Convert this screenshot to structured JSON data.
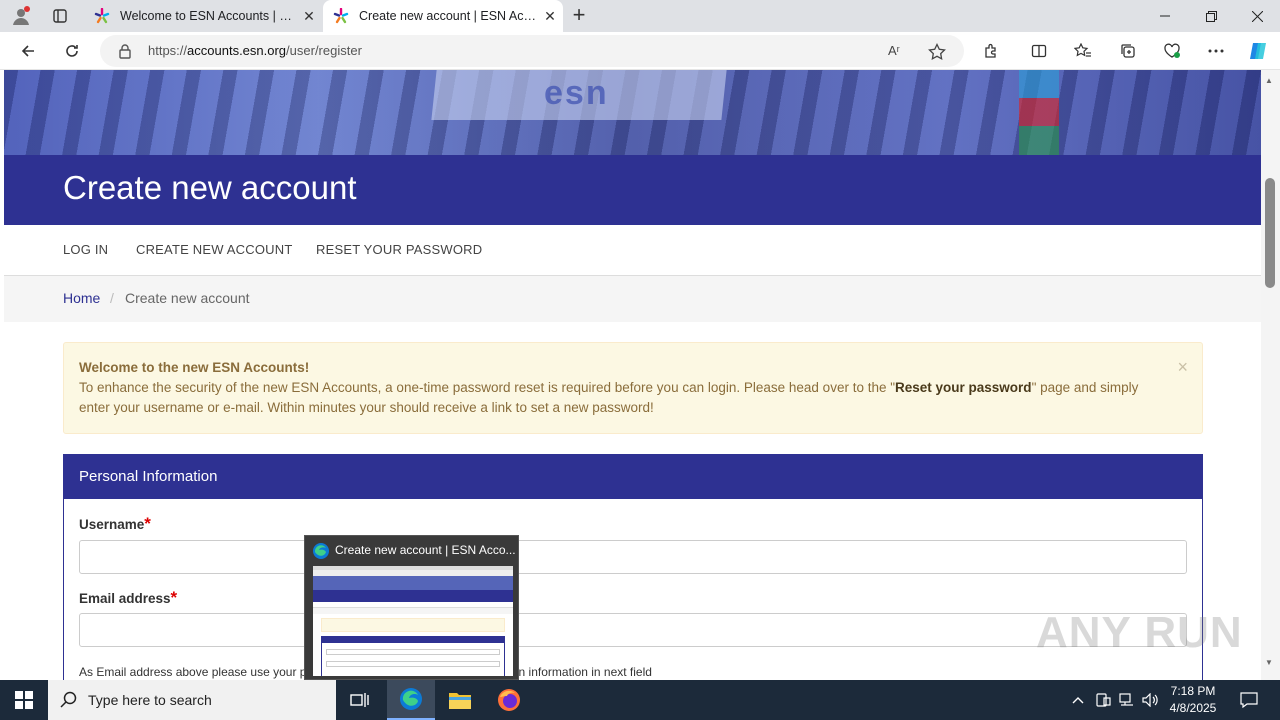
{
  "browser": {
    "tabs": [
      {
        "title": "Welcome to ESN Accounts | ESN",
        "active": false
      },
      {
        "title": "Create new account | ESN Accounts",
        "active": true
      }
    ],
    "url_prefix": "https://",
    "url_domain": "accounts.esn.org",
    "url_path": "/user/register",
    "read_aloud": "Aʳ"
  },
  "page": {
    "title": "Create new account",
    "nav": [
      "LOG IN",
      "CREATE NEW ACCOUNT",
      "RESET YOUR PASSWORD"
    ],
    "breadcrumb": {
      "home": "Home",
      "separator": "/",
      "current": "Create new account"
    },
    "alert": {
      "heading": "Welcome to the new ESN Accounts!",
      "body_before": "To enhance the security of the new ESN Accounts, a one-time password reset is required before you can login. Please head over to the \"",
      "body_bold": "Reset your password",
      "body_after": "\" page and simply enter your username or e-mail. Within minutes your should receive a link to set a new password!",
      "close": "×"
    },
    "panel": {
      "heading": "Personal Information",
      "username_label": "Username",
      "email_label": "Email address",
      "required_mark": "*",
      "email_help": "As Email address above please use your personal email. ESN email communication information in next field"
    },
    "hero_text": "esn"
  },
  "taskbar_preview": {
    "title": "Create new account | ESN Acco..."
  },
  "taskbar": {
    "search_placeholder": "Type here to search",
    "time": "7:18 PM",
    "date": "4/8/2025"
  },
  "watermark": "ANY RUN",
  "colors": {
    "brand": "#2e3192",
    "alert_bg": "#fcf8e3",
    "required": "#dd0000"
  }
}
